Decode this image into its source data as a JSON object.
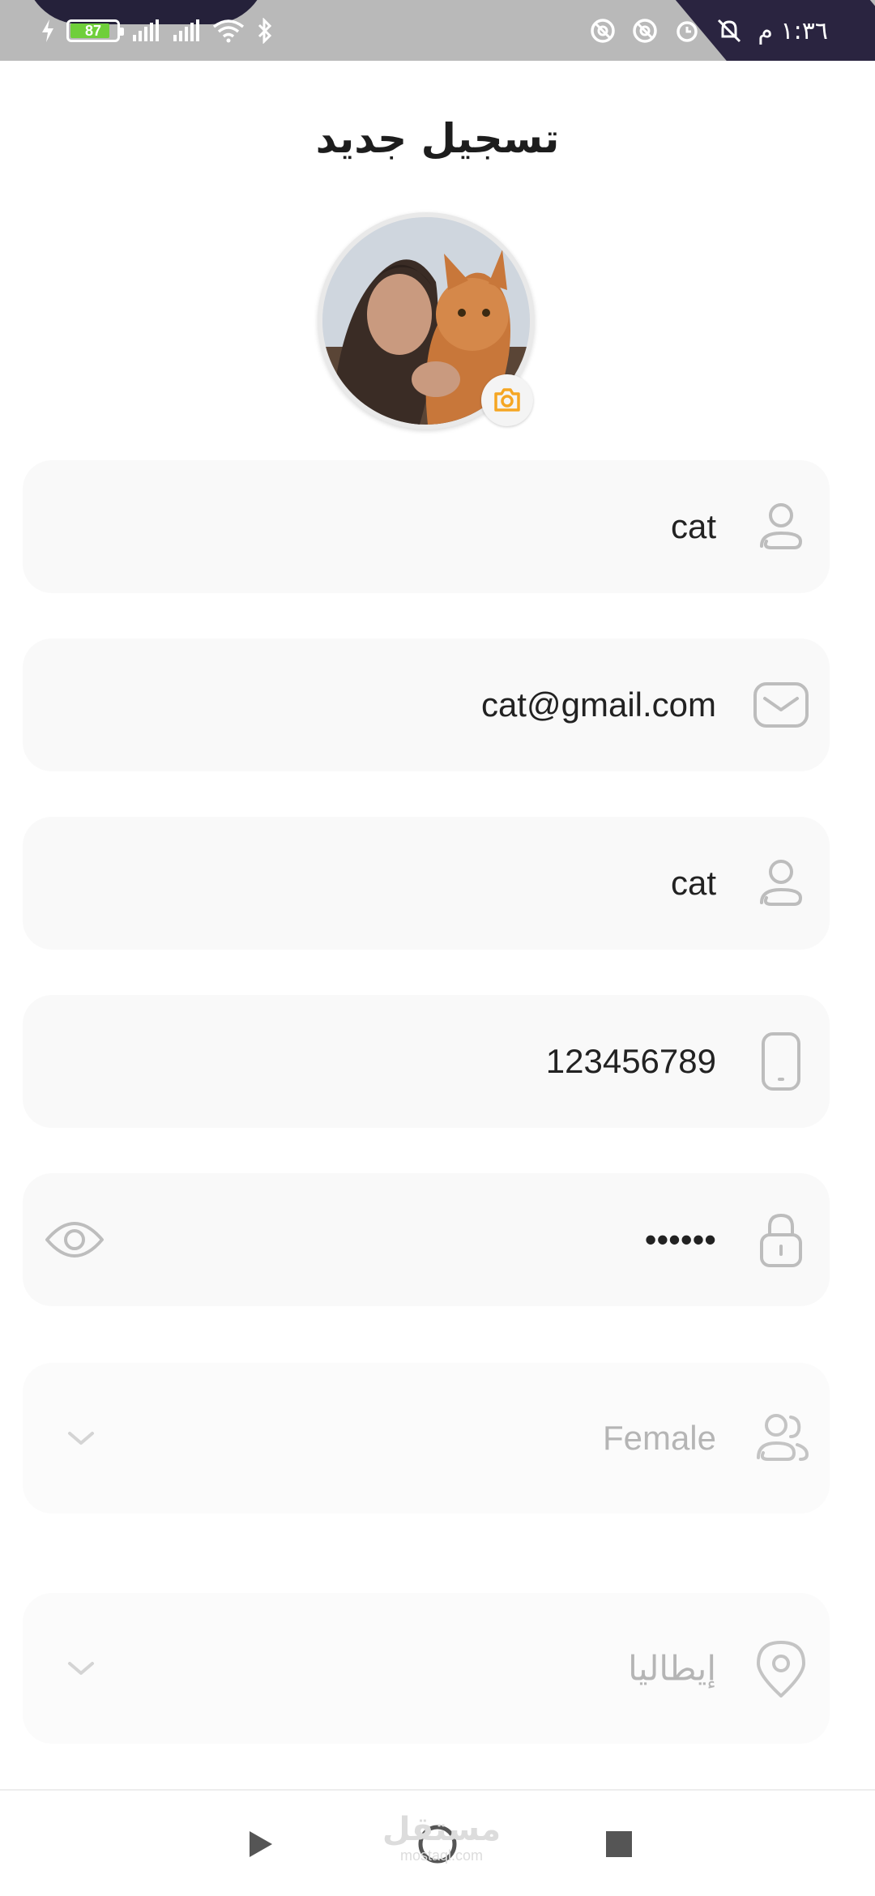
{
  "status_bar": {
    "battery_level": "87",
    "time": "١:٣٦ م",
    "icons": [
      "charging-icon",
      "signal-icon",
      "signal-icon",
      "wifi-icon",
      "bluetooth-icon",
      "sync-icon",
      "sync-icon",
      "alarm-icon",
      "mute-icon"
    ]
  },
  "header": {
    "title": "تسجيل جديد"
  },
  "profile": {
    "avatar_alt": "profile photo",
    "camera_icon": "camera-icon",
    "accent_color": "#f5a623"
  },
  "form": {
    "username": {
      "value": "cat",
      "icon": "user-icon"
    },
    "email": {
      "value": "cat@gmail.com",
      "icon": "mail-icon"
    },
    "display_name": {
      "value": "cat",
      "icon": "user-icon"
    },
    "phone": {
      "value": "123456789",
      "icon": "phone-icon"
    },
    "password": {
      "value": "••••••",
      "icon": "lock-icon",
      "toggle_icon": "eye-icon"
    },
    "gender": {
      "selected": "Female",
      "icon": "users-icon"
    },
    "country": {
      "selected": "إيطاليا",
      "icon": "location-icon"
    }
  },
  "nav_bar": {
    "buttons": [
      "back-icon",
      "home-icon",
      "recents-icon"
    ],
    "watermark_ar": "مستقل",
    "watermark_en": "mostaql.com"
  }
}
